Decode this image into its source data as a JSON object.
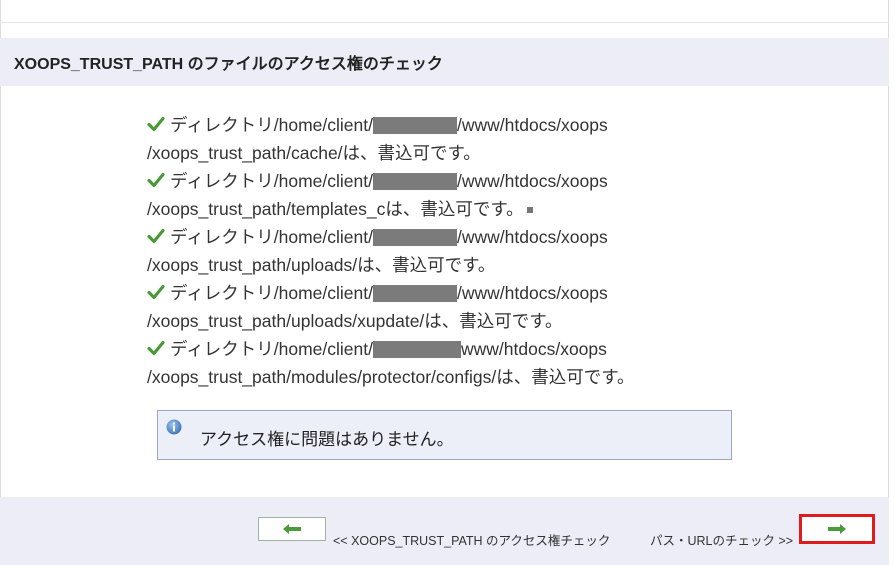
{
  "header": {
    "title": "XOOPS_TRUST_PATH のファイルのアクセス権のチェック"
  },
  "items": [
    {
      "prefix": "ディレクトリ/home/client/",
      "suffix": "/www/htdocs/xoops",
      "line2": "/xoops_trust_path/cache/は、書込可です。"
    },
    {
      "prefix": "ディレクトリ/home/client/",
      "suffix": "/www/htdocs/xoops",
      "line2": "/xoops_trust_path/templates_cは、書込可です。"
    },
    {
      "prefix": "ディレクトリ/home/client/",
      "suffix": "/www/htdocs/xoops",
      "line2": "/xoops_trust_path/uploads/は、書込可です。"
    },
    {
      "prefix": "ディレクトリ/home/client/",
      "suffix": "/www/htdocs/xoops",
      "line2": "/xoops_trust_path/uploads/xupdate/は、書込可です。"
    },
    {
      "prefix": "ディレクトリ/home/client/",
      "suffix": "www/htdocs/xoops",
      "line2": "/xoops_trust_path/modules/protector/configs/は、書込可です。"
    }
  ],
  "info": {
    "message": "アクセス権に問題はありません。"
  },
  "footer": {
    "back_label": "<< XOOPS_TRUST_PATH のアクセス権チェック",
    "next_label": "パス・URLのチェック >>"
  },
  "icons": {
    "check": "check-icon",
    "info": "info-icon",
    "back": "arrow-left-icon",
    "next": "arrow-right-icon"
  },
  "colors": {
    "accent_green": "#4a9a3a",
    "highlight_red": "#e01b1b",
    "panel_bg": "#ededf7"
  }
}
